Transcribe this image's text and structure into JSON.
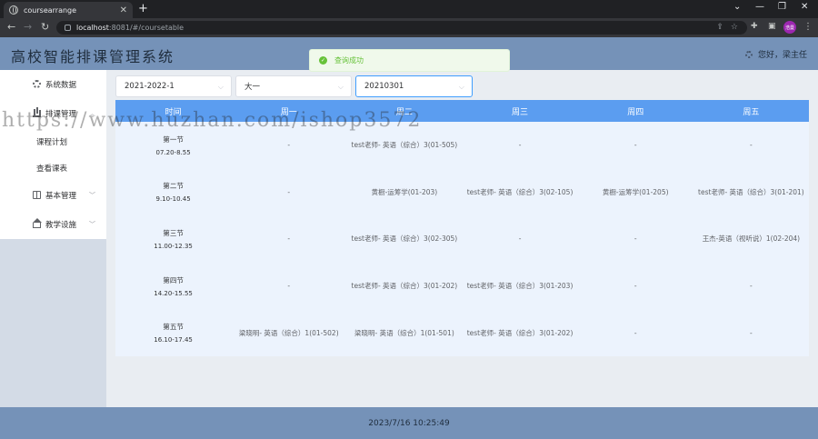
{
  "browser": {
    "tab_title": "coursearrange",
    "url_host": "localhost",
    "url_path": ":8081/#/coursetable",
    "new_tab": "+",
    "profile": "浩曼"
  },
  "app": {
    "title": "高校智能排课管理系统",
    "greeting": "您好，梁主任"
  },
  "toast": {
    "message": "查询成功"
  },
  "sidebar": {
    "items": [
      {
        "label": "系统数据",
        "icon": "gear-icon"
      },
      {
        "label": "排课管理",
        "icon": "bar-chart-icon",
        "expanded": true,
        "children": [
          {
            "label": "课程计划"
          },
          {
            "label": "查看课表"
          }
        ]
      },
      {
        "label": "基本管理",
        "icon": "book-icon"
      },
      {
        "label": "教学设施",
        "icon": "house-icon"
      }
    ]
  },
  "filters": {
    "semester": "2021-2022-1",
    "grade": "大一",
    "class_no": "20210301"
  },
  "timetable": {
    "headers": [
      "时间",
      "周一",
      "周二",
      "周三",
      "周四",
      "周五"
    ],
    "rows": [
      {
        "slot": "第一节",
        "time": "07.20-8.55",
        "cells": [
          "-",
          "test老师- 英语（综合）3(01-505)",
          "-",
          "-",
          "-"
        ]
      },
      {
        "slot": "第二节",
        "time": "9.10-10.45",
        "cells": [
          "-",
          "黄橱-运筹学(01-203)",
          "test老师- 英语（综合）3(02-105)",
          "黄橱-运筹学(01-205)",
          "test老师- 英语（综合）3(01-201)"
        ]
      },
      {
        "slot": "第三节",
        "time": "11.00-12.35",
        "cells": [
          "-",
          "test老师- 英语（综合）3(02-305)",
          "-",
          "-",
          "王杰-英语（视听说）1(02-204)"
        ]
      },
      {
        "slot": "第四节",
        "time": "14.20-15.55",
        "cells": [
          "-",
          "test老师- 英语（综合）3(01-202)",
          "test老师- 英语（综合）3(01-203)",
          "-",
          "-"
        ]
      },
      {
        "slot": "第五节",
        "time": "16.10-17.45",
        "cells": [
          "梁晓明- 英语（综合）1(01-502)",
          "梁晓明- 英语（综合）1(01-501)",
          "test老师- 英语（综合）3(01-202)",
          "-",
          "-"
        ]
      }
    ]
  },
  "footer": {
    "datetime": "2023/7/16 10:25:49"
  },
  "watermark": "https://www.huzhan.com/ishop3572"
}
